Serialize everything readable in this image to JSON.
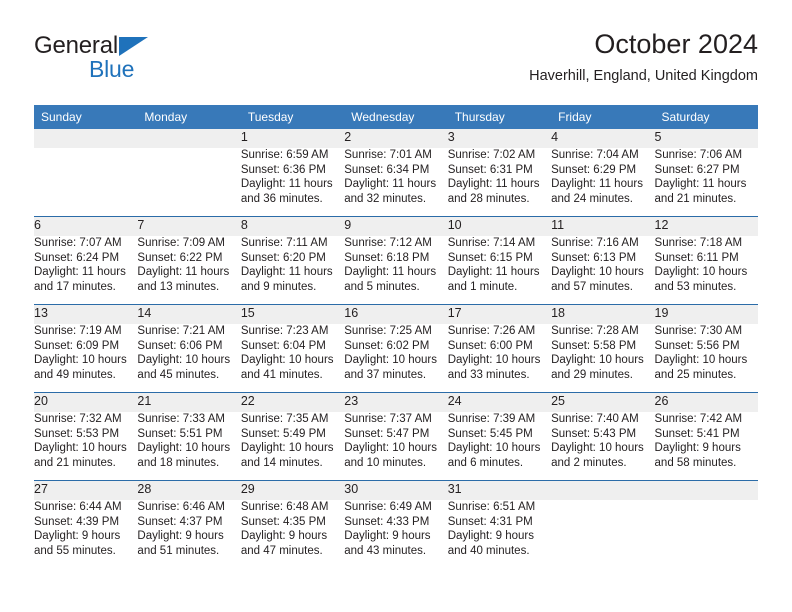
{
  "brand": {
    "word_one": "General",
    "word_two": "Blue",
    "triangle_color": "#1f72bb"
  },
  "header": {
    "title": "October 2024",
    "location": "Haverhill, England, United Kingdom"
  },
  "theme": {
    "header_blue": "#3879b9",
    "separator_blue": "#2b6ca8",
    "daynum_band": "#efefef",
    "text": "#231f20"
  },
  "weekday_headers": [
    "Sunday",
    "Monday",
    "Tuesday",
    "Wednesday",
    "Thursday",
    "Friday",
    "Saturday"
  ],
  "weeks": [
    {
      "days": [
        {
          "num": "",
          "sunrise": "",
          "sunset": "",
          "daylight_1": "",
          "daylight_2": ""
        },
        {
          "num": "",
          "sunrise": "",
          "sunset": "",
          "daylight_1": "",
          "daylight_2": ""
        },
        {
          "num": "1",
          "sunrise": "Sunrise: 6:59 AM",
          "sunset": "Sunset: 6:36 PM",
          "daylight_1": "Daylight: 11 hours",
          "daylight_2": "and 36 minutes."
        },
        {
          "num": "2",
          "sunrise": "Sunrise: 7:01 AM",
          "sunset": "Sunset: 6:34 PM",
          "daylight_1": "Daylight: 11 hours",
          "daylight_2": "and 32 minutes."
        },
        {
          "num": "3",
          "sunrise": "Sunrise: 7:02 AM",
          "sunset": "Sunset: 6:31 PM",
          "daylight_1": "Daylight: 11 hours",
          "daylight_2": "and 28 minutes."
        },
        {
          "num": "4",
          "sunrise": "Sunrise: 7:04 AM",
          "sunset": "Sunset: 6:29 PM",
          "daylight_1": "Daylight: 11 hours",
          "daylight_2": "and 24 minutes."
        },
        {
          "num": "5",
          "sunrise": "Sunrise: 7:06 AM",
          "sunset": "Sunset: 6:27 PM",
          "daylight_1": "Daylight: 11 hours",
          "daylight_2": "and 21 minutes."
        }
      ]
    },
    {
      "days": [
        {
          "num": "6",
          "sunrise": "Sunrise: 7:07 AM",
          "sunset": "Sunset: 6:24 PM",
          "daylight_1": "Daylight: 11 hours",
          "daylight_2": "and 17 minutes."
        },
        {
          "num": "7",
          "sunrise": "Sunrise: 7:09 AM",
          "sunset": "Sunset: 6:22 PM",
          "daylight_1": "Daylight: 11 hours",
          "daylight_2": "and 13 minutes."
        },
        {
          "num": "8",
          "sunrise": "Sunrise: 7:11 AM",
          "sunset": "Sunset: 6:20 PM",
          "daylight_1": "Daylight: 11 hours",
          "daylight_2": "and 9 minutes."
        },
        {
          "num": "9",
          "sunrise": "Sunrise: 7:12 AM",
          "sunset": "Sunset: 6:18 PM",
          "daylight_1": "Daylight: 11 hours",
          "daylight_2": "and 5 minutes."
        },
        {
          "num": "10",
          "sunrise": "Sunrise: 7:14 AM",
          "sunset": "Sunset: 6:15 PM",
          "daylight_1": "Daylight: 11 hours",
          "daylight_2": "and 1 minute."
        },
        {
          "num": "11",
          "sunrise": "Sunrise: 7:16 AM",
          "sunset": "Sunset: 6:13 PM",
          "daylight_1": "Daylight: 10 hours",
          "daylight_2": "and 57 minutes."
        },
        {
          "num": "12",
          "sunrise": "Sunrise: 7:18 AM",
          "sunset": "Sunset: 6:11 PM",
          "daylight_1": "Daylight: 10 hours",
          "daylight_2": "and 53 minutes."
        }
      ]
    },
    {
      "days": [
        {
          "num": "13",
          "sunrise": "Sunrise: 7:19 AM",
          "sunset": "Sunset: 6:09 PM",
          "daylight_1": "Daylight: 10 hours",
          "daylight_2": "and 49 minutes."
        },
        {
          "num": "14",
          "sunrise": "Sunrise: 7:21 AM",
          "sunset": "Sunset: 6:06 PM",
          "daylight_1": "Daylight: 10 hours",
          "daylight_2": "and 45 minutes."
        },
        {
          "num": "15",
          "sunrise": "Sunrise: 7:23 AM",
          "sunset": "Sunset: 6:04 PM",
          "daylight_1": "Daylight: 10 hours",
          "daylight_2": "and 41 minutes."
        },
        {
          "num": "16",
          "sunrise": "Sunrise: 7:25 AM",
          "sunset": "Sunset: 6:02 PM",
          "daylight_1": "Daylight: 10 hours",
          "daylight_2": "and 37 minutes."
        },
        {
          "num": "17",
          "sunrise": "Sunrise: 7:26 AM",
          "sunset": "Sunset: 6:00 PM",
          "daylight_1": "Daylight: 10 hours",
          "daylight_2": "and 33 minutes."
        },
        {
          "num": "18",
          "sunrise": "Sunrise: 7:28 AM",
          "sunset": "Sunset: 5:58 PM",
          "daylight_1": "Daylight: 10 hours",
          "daylight_2": "and 29 minutes."
        },
        {
          "num": "19",
          "sunrise": "Sunrise: 7:30 AM",
          "sunset": "Sunset: 5:56 PM",
          "daylight_1": "Daylight: 10 hours",
          "daylight_2": "and 25 minutes."
        }
      ]
    },
    {
      "days": [
        {
          "num": "20",
          "sunrise": "Sunrise: 7:32 AM",
          "sunset": "Sunset: 5:53 PM",
          "daylight_1": "Daylight: 10 hours",
          "daylight_2": "and 21 minutes."
        },
        {
          "num": "21",
          "sunrise": "Sunrise: 7:33 AM",
          "sunset": "Sunset: 5:51 PM",
          "daylight_1": "Daylight: 10 hours",
          "daylight_2": "and 18 minutes."
        },
        {
          "num": "22",
          "sunrise": "Sunrise: 7:35 AM",
          "sunset": "Sunset: 5:49 PM",
          "daylight_1": "Daylight: 10 hours",
          "daylight_2": "and 14 minutes."
        },
        {
          "num": "23",
          "sunrise": "Sunrise: 7:37 AM",
          "sunset": "Sunset: 5:47 PM",
          "daylight_1": "Daylight: 10 hours",
          "daylight_2": "and 10 minutes."
        },
        {
          "num": "24",
          "sunrise": "Sunrise: 7:39 AM",
          "sunset": "Sunset: 5:45 PM",
          "daylight_1": "Daylight: 10 hours",
          "daylight_2": "and 6 minutes."
        },
        {
          "num": "25",
          "sunrise": "Sunrise: 7:40 AM",
          "sunset": "Sunset: 5:43 PM",
          "daylight_1": "Daylight: 10 hours",
          "daylight_2": "and 2 minutes."
        },
        {
          "num": "26",
          "sunrise": "Sunrise: 7:42 AM",
          "sunset": "Sunset: 5:41 PM",
          "daylight_1": "Daylight: 9 hours",
          "daylight_2": "and 58 minutes."
        }
      ]
    },
    {
      "days": [
        {
          "num": "27",
          "sunrise": "Sunrise: 6:44 AM",
          "sunset": "Sunset: 4:39 PM",
          "daylight_1": "Daylight: 9 hours",
          "daylight_2": "and 55 minutes."
        },
        {
          "num": "28",
          "sunrise": "Sunrise: 6:46 AM",
          "sunset": "Sunset: 4:37 PM",
          "daylight_1": "Daylight: 9 hours",
          "daylight_2": "and 51 minutes."
        },
        {
          "num": "29",
          "sunrise": "Sunrise: 6:48 AM",
          "sunset": "Sunset: 4:35 PM",
          "daylight_1": "Daylight: 9 hours",
          "daylight_2": "and 47 minutes."
        },
        {
          "num": "30",
          "sunrise": "Sunrise: 6:49 AM",
          "sunset": "Sunset: 4:33 PM",
          "daylight_1": "Daylight: 9 hours",
          "daylight_2": "and 43 minutes."
        },
        {
          "num": "31",
          "sunrise": "Sunrise: 6:51 AM",
          "sunset": "Sunset: 4:31 PM",
          "daylight_1": "Daylight: 9 hours",
          "daylight_2": "and 40 minutes."
        },
        {
          "num": "",
          "sunrise": "",
          "sunset": "",
          "daylight_1": "",
          "daylight_2": ""
        },
        {
          "num": "",
          "sunrise": "",
          "sunset": "",
          "daylight_1": "",
          "daylight_2": ""
        }
      ]
    }
  ]
}
